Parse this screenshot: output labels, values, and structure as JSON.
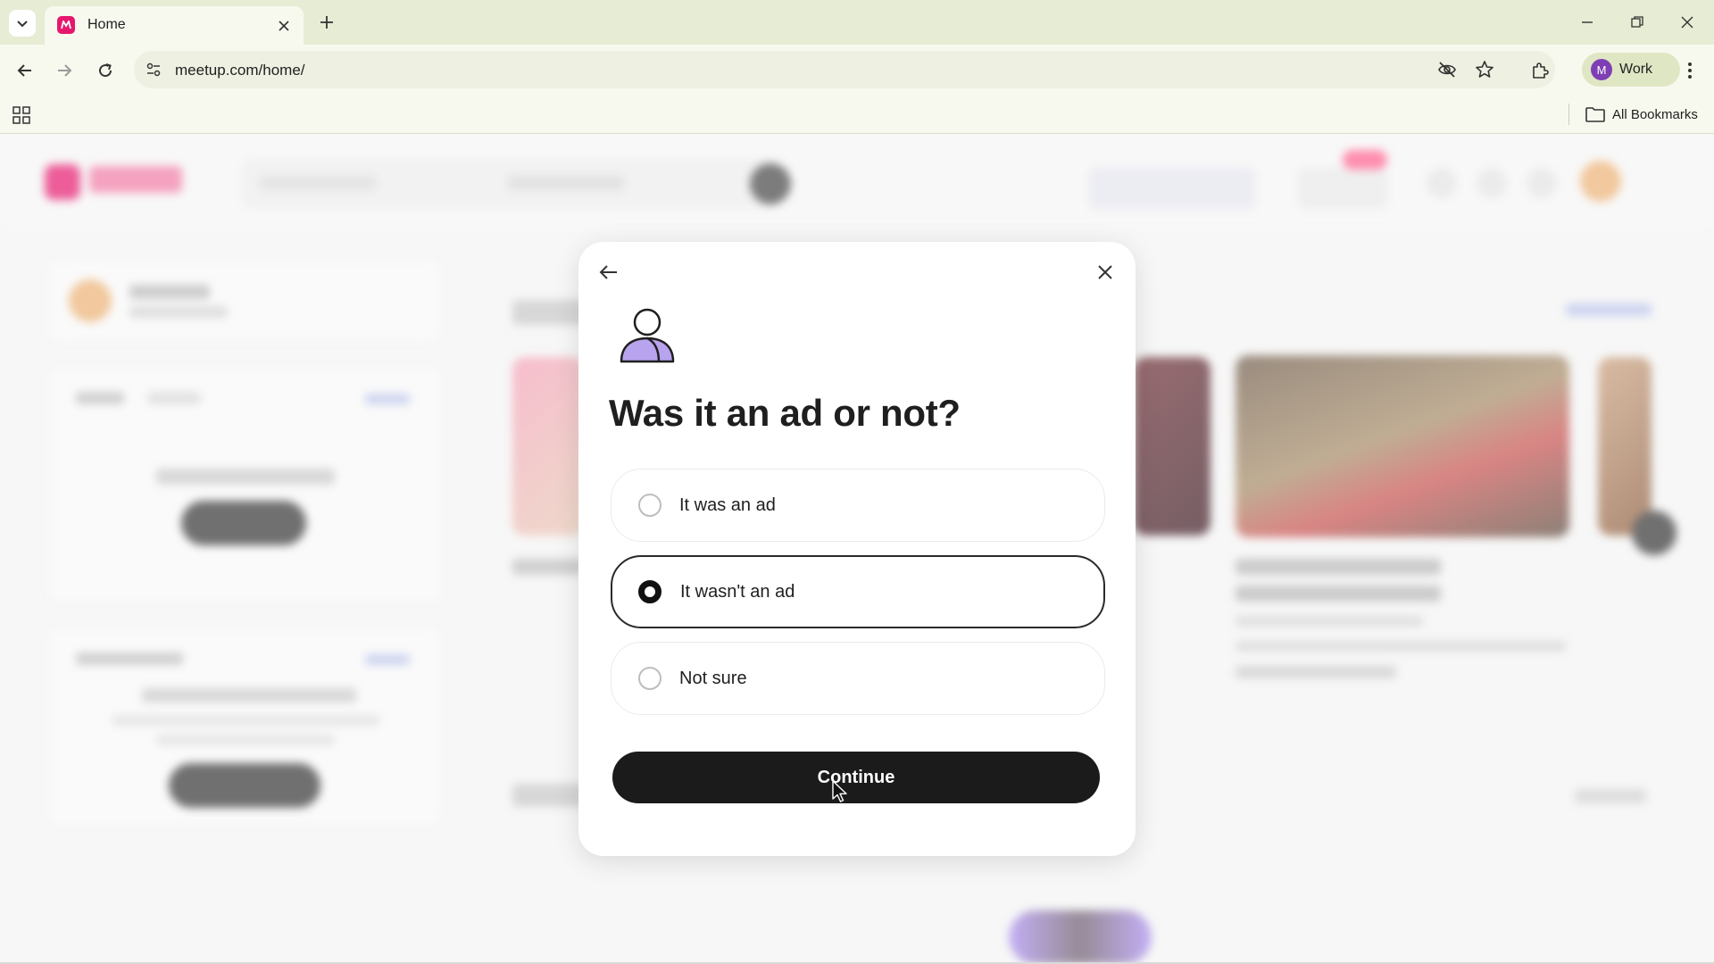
{
  "browser": {
    "tab": {
      "title": "Home",
      "favicon": "meetup-favicon"
    },
    "url": "meetup.com/home/",
    "profile": {
      "initial": "M",
      "label": "Work"
    },
    "bookmarks": {
      "all_label": "All Bookmarks"
    },
    "icons": [
      "tab-search-icon",
      "close-icon",
      "plus-icon",
      "minimize-icon",
      "restore-icon",
      "back-icon",
      "forward-icon",
      "reload-icon",
      "site-settings-icon",
      "eye-off-icon",
      "star-icon",
      "extensions-icon",
      "kebab-menu-icon",
      "apps-grid-icon",
      "folder-icon"
    ]
  },
  "modal": {
    "title": "Was it an ad or not?",
    "options": [
      {
        "label": "It was an ad",
        "selected": false
      },
      {
        "label": "It wasn't an ad",
        "selected": true
      },
      {
        "label": "Not sure",
        "selected": false
      }
    ],
    "continue_label": "Continue"
  },
  "colors": {
    "browser_tabbar": "#e7ecd4",
    "browser_toolbar": "#f8f9ee",
    "meetup_brand": "#e5186d",
    "profile_avatar": "#7e3fb5",
    "button_dark": "#1b1b1b",
    "illustration_purple": "#b7a3ee"
  }
}
